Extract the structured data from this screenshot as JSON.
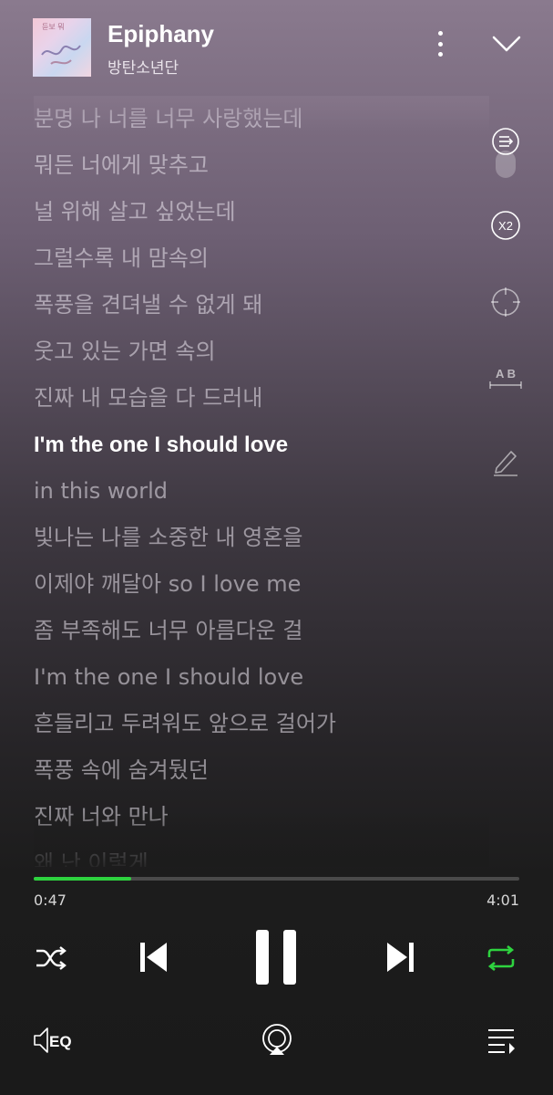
{
  "track": {
    "title": "Epiphany",
    "artist": "방탄소년단",
    "album_art_text": "듣보 뭐"
  },
  "lyrics": [
    "분명 나 너를 너무 사랑했는데",
    "뭐든 너에게 맞추고",
    "널 위해 살고 싶었는데",
    "그럴수록 내 맘속의",
    "폭풍을 견뎌낼 수 없게 돼",
    "웃고 있는 가면 속의",
    "진짜 내 모습을 다 드러내",
    "I'm the one I should love",
    "in this world",
    "빛나는 나를 소중한 내 영혼을",
    "이제야 깨달아 so I love me",
    "좀 부족해도 너무 아름다운 걸",
    "I'm the one I should love",
    "흔들리고 두려워도 앞으로 걸어가",
    "폭풍 속에 숨겨뒀던",
    "진짜 너와 만나",
    "왜 난 이렇게"
  ],
  "active_lyric_index": 7,
  "side_tools": {
    "speed_label": "X2",
    "translate_label": "A B"
  },
  "playback": {
    "current_time": "0:47",
    "total_time": "4:01",
    "progress_fraction": 0.2
  },
  "controls": {
    "repeat_active": true
  },
  "bottom_bar": {
    "eq_label": "EQ"
  },
  "colors": {
    "accent": "#2ed33f",
    "active_text": "#ffffff",
    "inactive_text": "#bdb5c0"
  }
}
